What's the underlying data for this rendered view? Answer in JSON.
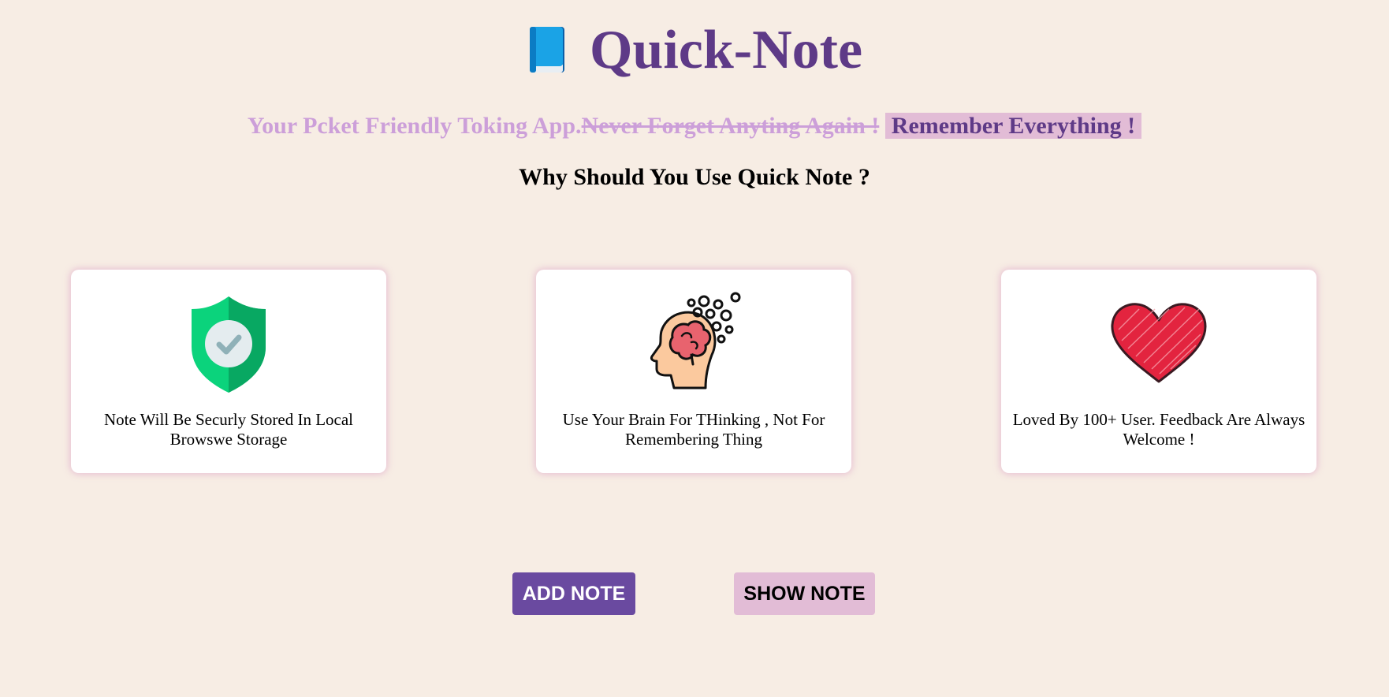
{
  "header": {
    "app_title": "Quick-Note",
    "icon": "blue-book-icon"
  },
  "tagline": {
    "part1": "Your Pcket Friendly Toking App.",
    "part2": "Never Forget Anyting Again !",
    "part3": "Remember Everything !"
  },
  "section": {
    "heading": "Why Should You Use Quick Note ?"
  },
  "cards": [
    {
      "icon": "shield-check-icon",
      "text": "Note Will Be Securly Stored In Local Browswe Storage"
    },
    {
      "icon": "brain-head-icon",
      "text": "Use Your Brain For THinking , Not For Remembering Thing"
    },
    {
      "icon": "heart-icon",
      "text": "Loved By 100+ User. Feedback Are Always Welcome !"
    }
  ],
  "buttons": {
    "add_label": "ADD NOTE",
    "show_label": "SHOW NOTE"
  },
  "colors": {
    "background": "#f7ede4",
    "title": "#5e3a87",
    "tagline_light": "#cc9fd9",
    "highlight": "#e2bcd6",
    "add_button": "#6a4aa0"
  }
}
